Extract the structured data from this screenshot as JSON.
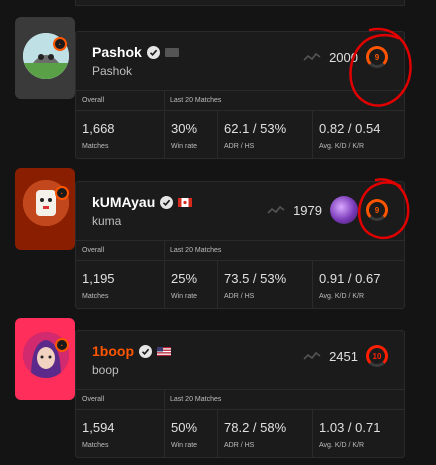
{
  "headers": {
    "overall": "Overall",
    "last20": "Last 20 Matches"
  },
  "stat_labels": {
    "matches": "Matches",
    "winrate": "Win rate",
    "adr_hs": "ADR / HS",
    "kd_kr": "Avg. K/D / K/R"
  },
  "colors": {
    "faceit_orange": "#ff5500",
    "level10_red": "#fe1f00",
    "annotation": "#e00000"
  },
  "players": [
    {
      "name": "Pashok",
      "nickname": "Pashok",
      "flag": "neutral",
      "name_color": "white",
      "elo": "2000",
      "level": "9",
      "matches": "1,668",
      "winrate": "30%",
      "adr_hs": "62.1 / 53%",
      "kd_kr": "0.82 / 0.54"
    },
    {
      "name": "kUMAyau",
      "nickname": "kuma",
      "flag": "canada",
      "name_color": "white",
      "elo": "1979",
      "level": "9",
      "matches": "1,195",
      "winrate": "25%",
      "adr_hs": "73.5 / 53%",
      "kd_kr": "0.91 / 0.67"
    },
    {
      "name": "1boop",
      "nickname": "boop",
      "flag": "usa",
      "name_color": "orange",
      "elo": "2451",
      "level": "10",
      "matches": "1,594",
      "winrate": "50%",
      "adr_hs": "78.2 / 58%",
      "kd_kr": "1.03 / 0.71"
    }
  ]
}
